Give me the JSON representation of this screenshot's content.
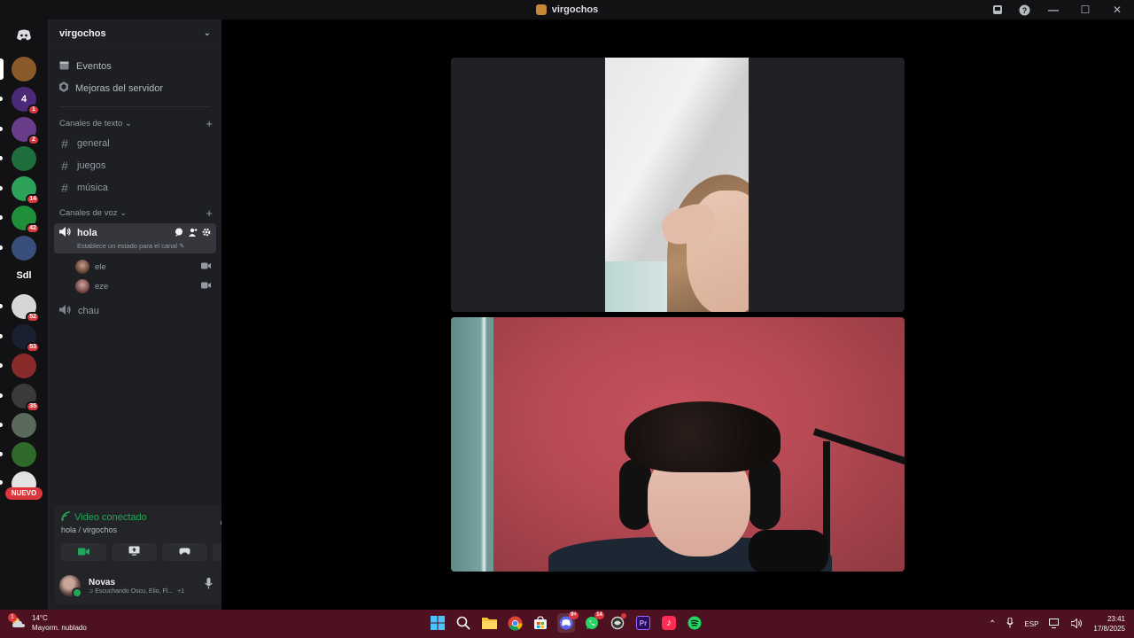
{
  "window": {
    "title": "virgochos"
  },
  "servers": {
    "items": [
      {
        "name": "server-1",
        "badge": "",
        "color": "#8a5a2b"
      },
      {
        "name": "server-2",
        "badge": "1",
        "color": "#4b2a7a",
        "label": "4"
      },
      {
        "name": "server-3",
        "badge": "2",
        "color": "#6a3d8a"
      },
      {
        "name": "server-4",
        "badge": "",
        "color": "#1f6f3e"
      },
      {
        "name": "server-5",
        "badge": "14",
        "color": "#2ea15a"
      },
      {
        "name": "server-6",
        "badge": "42",
        "color": "#1f8f3a"
      },
      {
        "name": "server-7",
        "badge": "",
        "color": "#3a4e7a"
      },
      {
        "name": "server-sdl",
        "badge": "",
        "color": "#121214",
        "label": "Sdl"
      },
      {
        "name": "server-9",
        "badge": "52",
        "color": "#d6d6d6"
      },
      {
        "name": "server-10",
        "badge": "53",
        "color": "#1a2030"
      },
      {
        "name": "server-11",
        "badge": "",
        "color": "#8a2b2b"
      },
      {
        "name": "server-12",
        "badge": "35",
        "color": "#3a3a3a"
      },
      {
        "name": "server-13",
        "badge": "",
        "color": "#5a6a5a"
      },
      {
        "name": "server-14",
        "badge": "",
        "color": "#2f6a2a"
      },
      {
        "name": "server-15",
        "badge": "",
        "color": "#e2e2e2"
      }
    ],
    "new_label": "NUEVO"
  },
  "sidebar": {
    "guild_name": "virgochos",
    "events_label": "Eventos",
    "boosts_label": "Mejoras del servidor",
    "text_category": "Canales de texto",
    "text_channels": [
      "general",
      "juegos",
      "música"
    ],
    "voice_category": "Canales de voz",
    "active_voice_channel": "hola",
    "active_status_placeholder": "Establece un estado para el canal",
    "voice_users": [
      "ele",
      "eze"
    ],
    "other_voice_channel": "chau"
  },
  "voice_panel": {
    "status": "Video conectado",
    "location": "hola / virgochos"
  },
  "user": {
    "name": "Novas",
    "activity": "Escuchando Oscu, Elio, Fl...",
    "activity_extra": "+1"
  },
  "taskbar": {
    "temperature": "14°C",
    "weather": "Mayorm. nublado",
    "weather_badge": "1",
    "discord_badge": "9+",
    "whatsapp_badge": "14",
    "language": "ESP",
    "time": "23:41",
    "date": "17/8/2025"
  }
}
